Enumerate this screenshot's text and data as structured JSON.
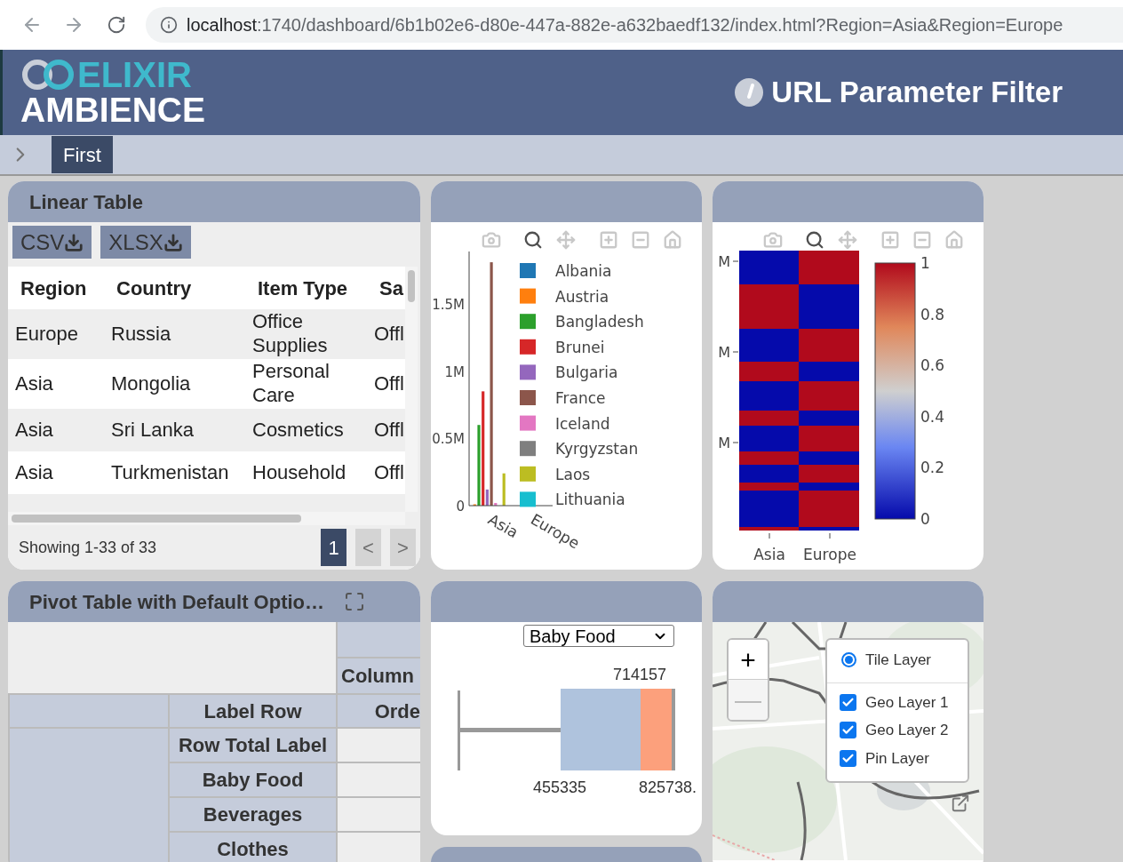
{
  "browser": {
    "url_host": "localhost",
    "url_rest": ":1740/dashboard/6b1b02e6-d80e-447a-882e-a632baedf132/index.html?Region=Asia&Region=Europe"
  },
  "header": {
    "logo_top": "ELIXIR",
    "logo_bottom": "AMBIENCE",
    "title": "URL Parameter Filter"
  },
  "breadcrumb": [
    {
      "label": "First",
      "selected": true
    }
  ],
  "linear_table": {
    "title": "Linear Table",
    "exports": [
      "CSV",
      "XLSX"
    ],
    "columns": [
      "Region",
      "Country",
      "Item Type",
      "Sa"
    ],
    "rows": [
      [
        "Europe",
        "Russia",
        "Office Supplies",
        "Offl"
      ],
      [
        "Asia",
        "Mongolia",
        "Personal Care",
        "Offl"
      ],
      [
        "Asia",
        "Sri Lanka",
        "Cosmetics",
        "Offl"
      ],
      [
        "Asia",
        "Turkmenistan",
        "Household",
        "Offl"
      ]
    ],
    "footer": "Showing 1-33 of 33",
    "pages": [
      {
        "label": "1",
        "selected": true
      }
    ],
    "prev": {
      "label": "<",
      "disabled": true
    },
    "next": {
      "label": ">",
      "disabled": true
    }
  },
  "bar_panel": {
    "modebar": [
      {
        "selected": false
      },
      {
        "selected": true
      },
      {
        "selected": false
      },
      {
        "selected": false
      },
      {
        "selected": false
      },
      {
        "selected": false
      }
    ],
    "chart_data": {
      "type": "bar",
      "categories": [
        "Asia",
        "Europe"
      ],
      "ylim": [
        0,
        1890000
      ],
      "legend": "right",
      "yticks": [
        {
          "value": 0,
          "label": "0"
        },
        {
          "value": 500000,
          "label": "0.5M"
        },
        {
          "value": 1000000,
          "label": "1M"
        },
        {
          "value": 1500000,
          "label": "1.5M"
        }
      ],
      "series": [
        {
          "name": "Albania",
          "color": "#1f77b4",
          "values": [
            null,
            null
          ]
        },
        {
          "name": "Austria",
          "color": "#ff7f0e",
          "values": [
            10000,
            null
          ]
        },
        {
          "name": "Bangladesh",
          "color": "#2ca02c",
          "values": [
            600000,
            null
          ]
        },
        {
          "name": "Brunei",
          "color": "#d62728",
          "values": [
            850000,
            null
          ]
        },
        {
          "name": "Bulgaria",
          "color": "#9467bd",
          "values": [
            120000,
            null
          ]
        },
        {
          "name": "France",
          "color": "#8c564b",
          "values": [
            1810000,
            null
          ]
        },
        {
          "name": "Iceland",
          "color": "#e377c2",
          "values": [
            20000,
            null
          ]
        },
        {
          "name": "Kyrgyzstan",
          "color": "#7f7f7f",
          "values": [
            null,
            null
          ]
        },
        {
          "name": "Laos",
          "color": "#bcbd22",
          "values": [
            240000,
            null
          ]
        },
        {
          "name": "Lithuania",
          "color": "#17becf",
          "values": [
            null,
            null
          ]
        }
      ]
    }
  },
  "heatmap_panel": {
    "modebar": [
      {
        "selected": false
      },
      {
        "selected": true
      },
      {
        "selected": false
      },
      {
        "selected": false
      },
      {
        "selected": false
      },
      {
        "selected": false
      }
    ],
    "yticks": [
      "M",
      "M",
      "M"
    ],
    "x_labels": [
      "Asia",
      "Europe"
    ],
    "colorbar_ticks": [
      "1",
      "0.8",
      "0.6",
      "0.4",
      "0.2",
      "0"
    ]
  },
  "pivot": {
    "title": "Pivot Table with Default Optio…",
    "column_header": "Column",
    "row_header": "Label Row",
    "value_header": "Orde",
    "rows": [
      "Row Total Label",
      "Baby Food",
      "Beverages",
      "Clothes"
    ]
  },
  "box_panel": {
    "select": "Baby Food",
    "top_label": "714157",
    "bottom_left_label": "455335",
    "bottom_right_label": "825738."
  },
  "map_panel": {
    "zoom_in": {
      "label": "+",
      "disabled": false
    },
    "zoom_out": {
      "label": "—",
      "disabled": true
    },
    "base_layers": [
      {
        "label": "Tile Layer",
        "selected": true
      }
    ],
    "overlays": [
      {
        "label": "Geo Layer 1",
        "checked": true
      },
      {
        "label": "Geo Layer 2",
        "checked": true
      },
      {
        "label": "Pin Layer",
        "checked": true
      }
    ]
  }
}
